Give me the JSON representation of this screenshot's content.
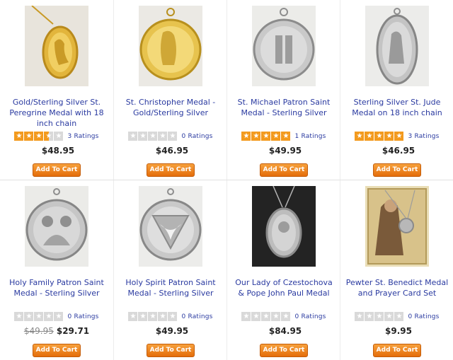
{
  "colors": {
    "link": "#2a3aa0",
    "star_on": "#f39a1e",
    "star_off": "#d9d9d9",
    "button": "#f08a1c"
  },
  "products": [
    {
      "title": "Gold/Sterling Silver St. Peregrine Medal with 18 inch chain",
      "rating": 3.5,
      "ratings_text": "3 Ratings",
      "price": "$48.95",
      "old_price": "",
      "button": "Add To Cart",
      "image": "gold-oval-medal-icon"
    },
    {
      "title": "St. Christopher Medal - Gold/Sterling Silver",
      "rating": 0,
      "ratings_text": "0 Ratings",
      "price": "$46.95",
      "old_price": "",
      "button": "Add To Cart",
      "image": "gold-round-medal-icon"
    },
    {
      "title": "St. Michael Patron Saint Medal - Sterling Silver",
      "rating": 5,
      "ratings_text": "1 Ratings",
      "price": "$49.95",
      "old_price": "",
      "button": "Add To Cart",
      "image": "silver-round-medal-icon"
    },
    {
      "title": "Sterling Silver St. Jude Medal on 18 inch chain",
      "rating": 5,
      "ratings_text": "3 Ratings",
      "price": "$46.95",
      "old_price": "",
      "button": "Add To Cart",
      "image": "silver-oval-medal-icon"
    },
    {
      "title": "Holy Family Patron Saint Medal - Sterling Silver",
      "rating": 0,
      "ratings_text": "0 Ratings",
      "price": "$29.71",
      "old_price": "$49.95",
      "button": "Add To Cart",
      "image": "silver-round-medal-icon"
    },
    {
      "title": "Holy Spirit Patron Saint Medal - Sterling Silver",
      "rating": 0,
      "ratings_text": "0 Ratings",
      "price": "$49.95",
      "old_price": "",
      "button": "Add To Cart",
      "image": "dove-medal-icon"
    },
    {
      "title": "Our Lady of Czestochova & Pope John Paul Medal",
      "rating": 0,
      "ratings_text": "0 Ratings",
      "price": "$84.95",
      "old_price": "",
      "button": "Add To Cart",
      "image": "silver-oval-medal-icon"
    },
    {
      "title": "Pewter St. Benedict Medal and Prayer Card Set",
      "rating": 0,
      "ratings_text": "0 Ratings",
      "price": "$9.95",
      "old_price": "",
      "button": "Add To Cart",
      "image": "prayer-card-set-icon"
    }
  ]
}
